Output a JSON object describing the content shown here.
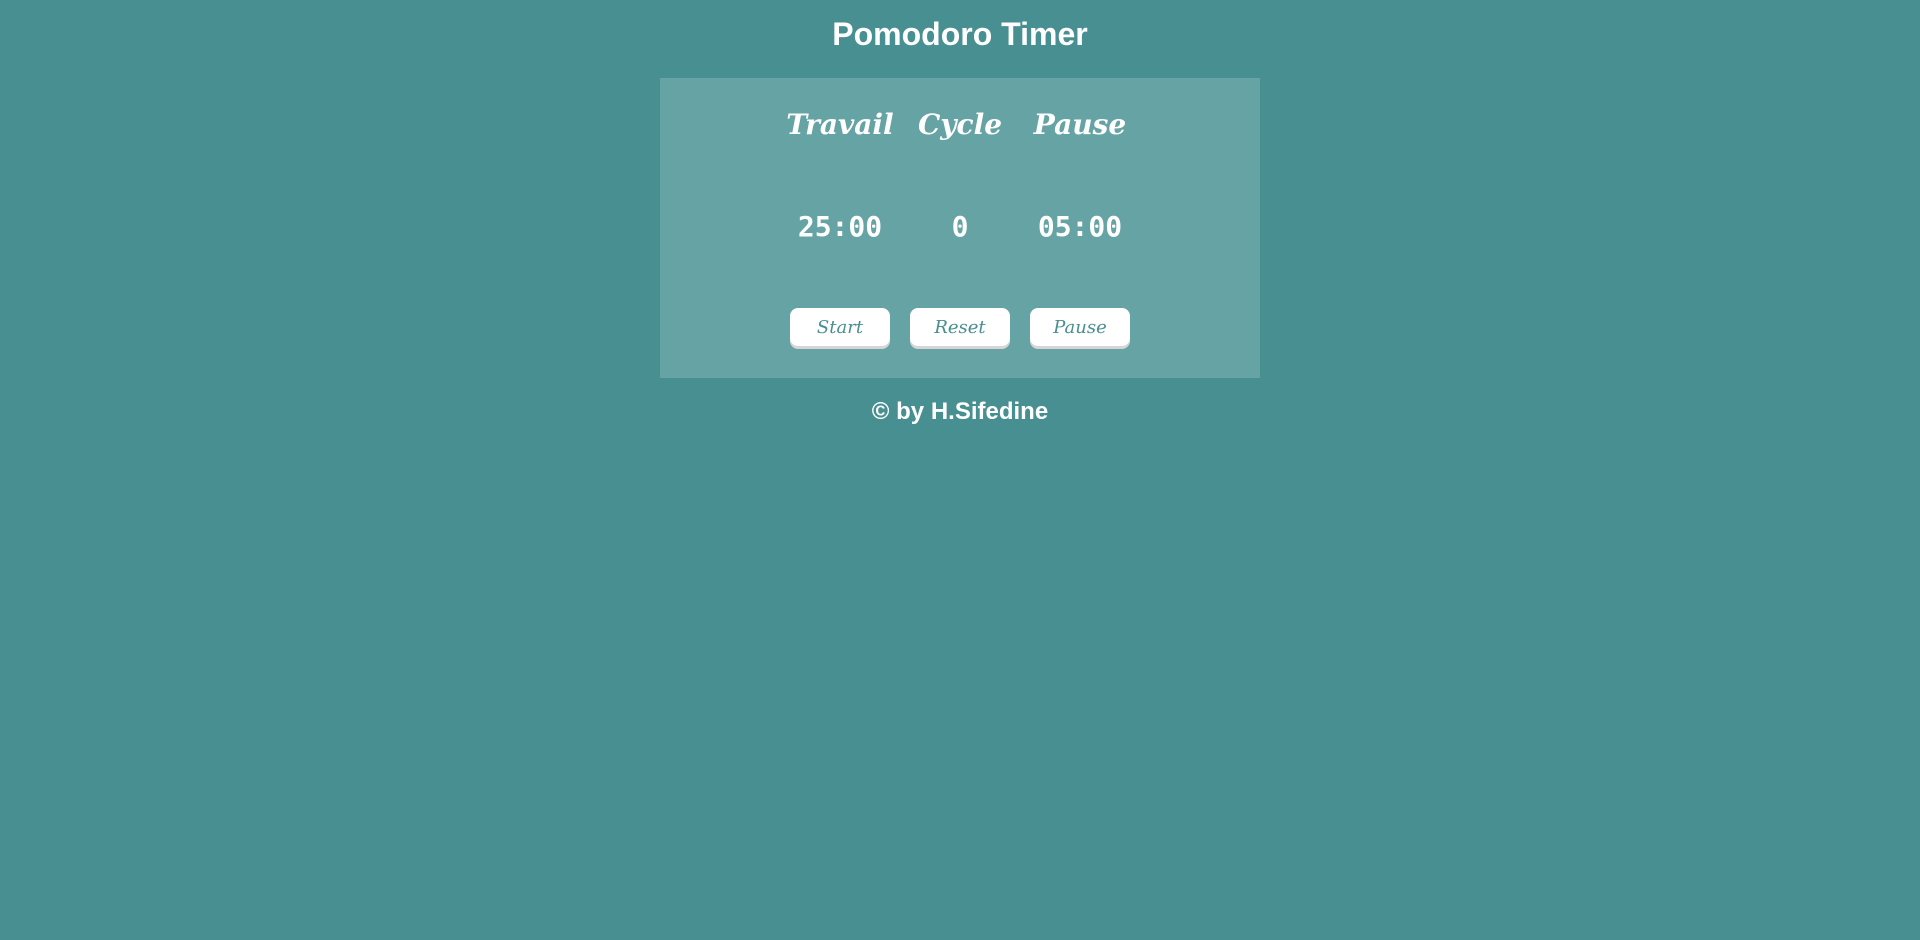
{
  "header": {
    "title": "Pomodoro Timer"
  },
  "timer": {
    "labels": {
      "work": "Travail",
      "cycle": "Cycle",
      "pause": "Pause"
    },
    "values": {
      "work": "25:00",
      "cycle": "0",
      "pause": "05:00"
    }
  },
  "buttons": {
    "start": "Start",
    "reset": "Reset",
    "pause": "Pause"
  },
  "footer": {
    "text": "© by H.Sifedine"
  },
  "colors": {
    "background": "#488f91",
    "panel": "#66a3a4",
    "button_text": "#488f91"
  }
}
